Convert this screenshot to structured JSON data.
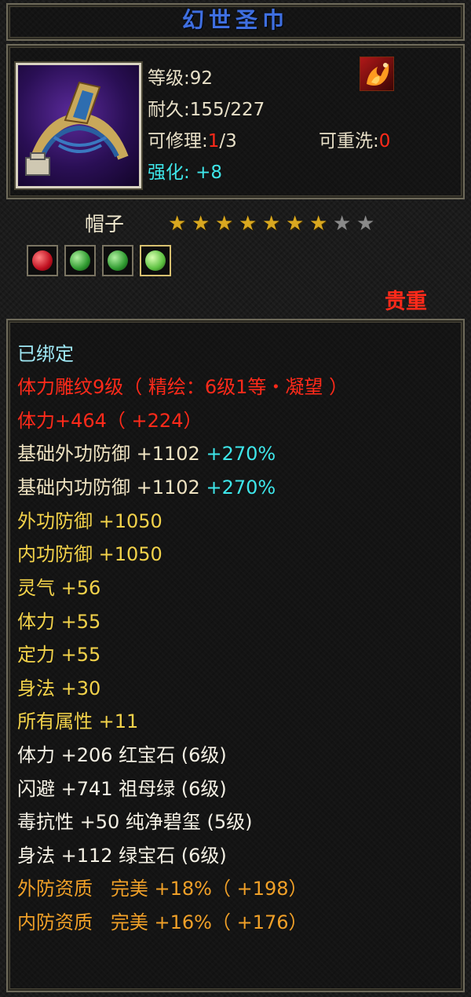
{
  "item": {
    "name": "幻世圣巾",
    "level_text": "等级:92",
    "durability_text": "耐久:155/227",
    "repair_label": "可修理:",
    "repair_current": "1",
    "repair_max": "/3",
    "rewash_label": "可重洗:",
    "rewash_value": "0",
    "enhance_label": "强化:",
    "enhance_value": "+8",
    "type": "帽子",
    "stars_filled": 7,
    "stars_total": 9,
    "rarity": "贵重",
    "icon": "headband-item-icon",
    "badge_icon": "flame-bird-icon"
  },
  "gems": [
    {
      "name": "red-gem-icon",
      "color": "#e0202a"
    },
    {
      "name": "green-gem-icon",
      "color": "#3fb040"
    },
    {
      "name": "green-gem-icon",
      "color": "#3fb040"
    },
    {
      "name": "jade-gem-icon",
      "color": "#6ad06a"
    }
  ],
  "stats": {
    "bound": "已绑定",
    "engrave": "体力雕纹9级（ 精绘：6级1等・凝望 ）",
    "stamina_bonus": "体力+464（ +224）",
    "base_ext_def_label": "基础外功防御 +1102",
    "base_ext_def_pct": "+270%",
    "base_int_def_label": "基础内功防御 +1102",
    "base_int_def_pct": "+270%",
    "ext_def": "外功防御 +1050",
    "int_def": "内功防御 +1050",
    "aura": "灵气 +56",
    "stamina": "体力 +55",
    "focus": "定力 +55",
    "agility": "身法 +30",
    "all_attr": "所有属性 +11",
    "gem1": "体力 +206 红宝石 (6级)",
    "gem2": "闪避 +741 祖母绿 (6级)",
    "gem3": "毒抗性 +50 纯净碧玺 (5级)",
    "gem4": "身法 +112 绿宝石 (6级)",
    "q1_label": "外防资质",
    "q1_value": "完美 +18%（ +198）",
    "q2_label": "内防资质",
    "q2_value": "完美 +16%（ +176）"
  },
  "colors": {
    "title": "#3f6fe0",
    "red": "#ff2a1a",
    "cyan": "#3ee6ea",
    "yellow": "#f2d24a",
    "orange": "#f0a028"
  }
}
